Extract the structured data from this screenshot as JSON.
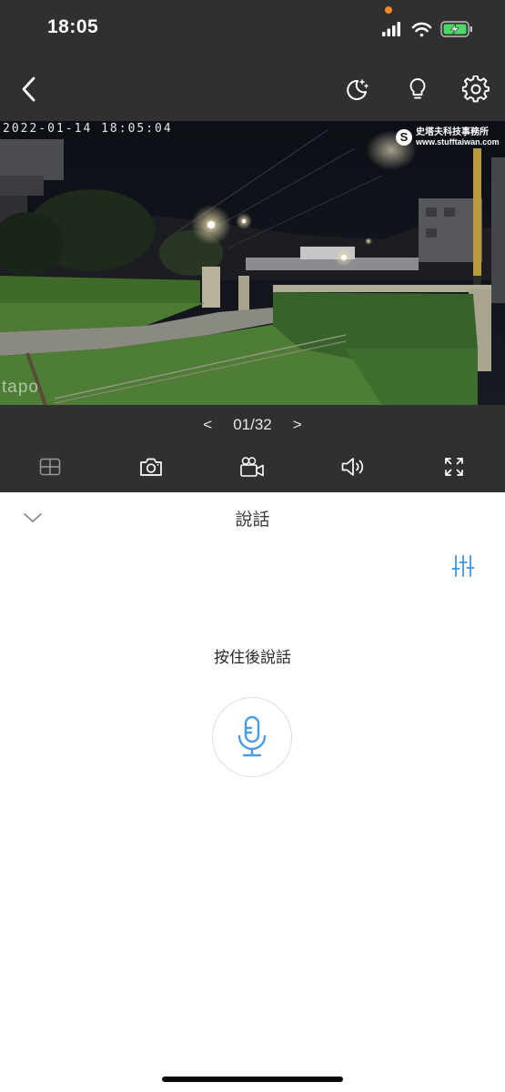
{
  "status_bar": {
    "time": "18:05",
    "icons": [
      "signal-icon",
      "wifi-icon",
      "battery-charging-icon"
    ],
    "indicator_color": "#f08a24"
  },
  "nav": {
    "icons": [
      "back-icon",
      "night-mode-icon",
      "light-bulb-icon",
      "settings-icon"
    ]
  },
  "video": {
    "timestamp": "2022-01-14  18:05:04",
    "watermark_cn": "史塔夫科技事務所",
    "watermark_url": "www.stufftaiwan.com",
    "watermark_letter": "S",
    "brand": "tapo"
  },
  "pager": {
    "prev": "<",
    "label": "01/32",
    "next": ">"
  },
  "toolbar": {
    "icons": [
      "grid-view-icon",
      "camera-icon",
      "video-record-icon",
      "speaker-icon",
      "fullscreen-icon"
    ]
  },
  "talk_panel": {
    "title": "說話",
    "hint": "按住後說話",
    "accent_color": "#4a9ae6"
  }
}
